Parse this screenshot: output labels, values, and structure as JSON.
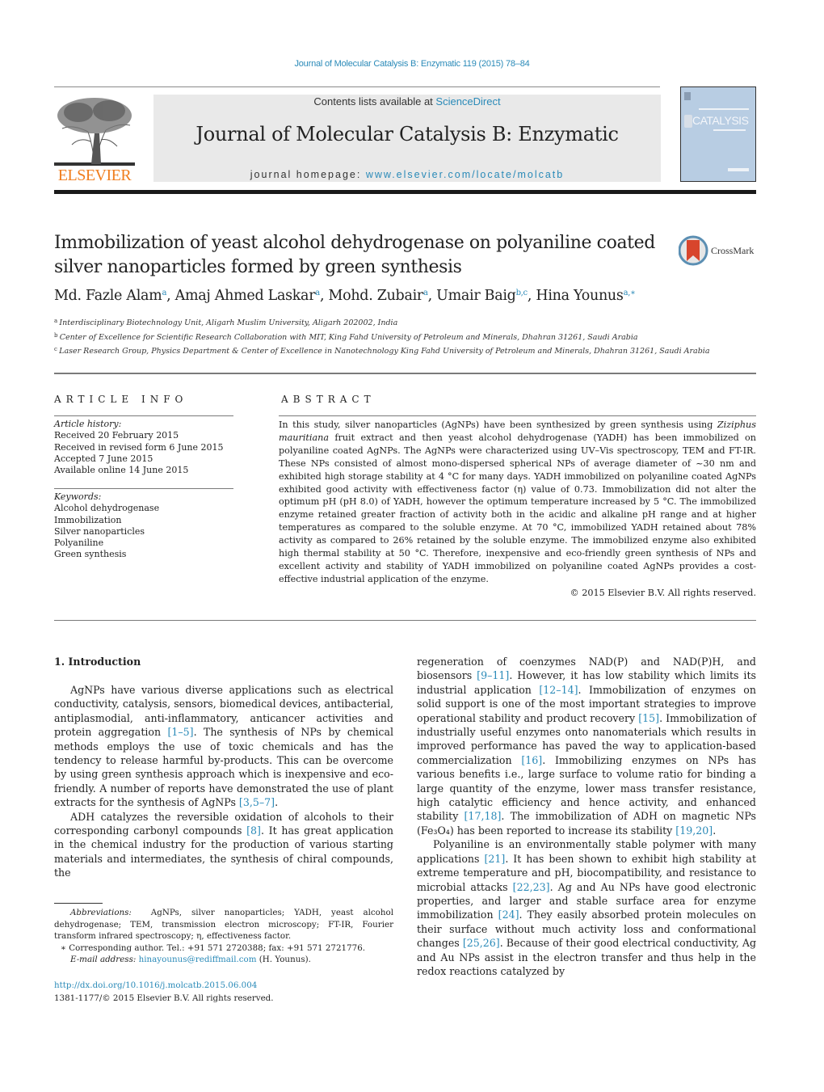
{
  "header": {
    "citation": "Journal of Molecular Catalysis B: Enzymatic 119 (2015) 78–84",
    "contents_prefix": "Contents lists available at ",
    "contents_link": "ScienceDirect",
    "journal_title": "Journal of Molecular Catalysis B: Enzymatic",
    "homepage_prefix": "journal homepage: ",
    "homepage_link": "www.elsevier.com/locate/molcatb",
    "publisher_logo_text": "ELSEVIER",
    "cover_title": "CATALYSIS",
    "accent_color": "#2a8ab8",
    "logo_color": "#f07e1e"
  },
  "article": {
    "title": "Immobilization of yeast alcohol dehydrogenase on polyaniline coated silver nanoparticles formed by green synthesis",
    "crossmark_label": "CrossMark",
    "authors": [
      {
        "name": "Md. Fazle Alam",
        "sup": "a",
        "sep": ", "
      },
      {
        "name": "Amaj Ahmed Laskar",
        "sup": "a",
        "sep": ", "
      },
      {
        "name": "Mohd. Zubair",
        "sup": "a",
        "sep": ", "
      },
      {
        "name": "Umair Baig",
        "sup": "b,c",
        "sep": ", "
      },
      {
        "name": "Hina Younus",
        "sup": "a,∗",
        "sep": ""
      }
    ],
    "affiliations": [
      {
        "key": "a",
        "text": "Interdisciplinary Biotechnology Unit, Aligarh Muslim University, Aligarh 202002, India"
      },
      {
        "key": "b",
        "text": "Center of Excellence for Scientific Research Collaboration with MIT, King Fahd University of Petroleum and Minerals, Dhahran 31261, Saudi Arabia"
      },
      {
        "key": "c",
        "text": "Laser Research Group, Physics Department & Center of Excellence in Nanotechnology King Fahd University of Petroleum and Minerals, Dhahran 31261, Saudi Arabia"
      }
    ]
  },
  "article_info": {
    "heading": "ARTICLE INFO",
    "history_label": "Article history:",
    "history": [
      "Received 20 February 2015",
      "Received in revised form 6 June 2015",
      "Accepted 7 June 2015",
      "Available online 14 June 2015"
    ],
    "keywords_label": "Keywords:",
    "keywords": [
      "Alcohol dehydrogenase",
      "Immobilization",
      "Silver nanoparticles",
      "Polyaniline",
      "Green synthesis"
    ]
  },
  "abstract": {
    "heading": "ABSTRACT",
    "text_1": "In this study, silver nanoparticles (AgNPs) have been synthesized by green synthesis using ",
    "species": "Ziziphus mauritiana",
    "text_2": " fruit extract and then yeast alcohol dehydrogenase (YADH) has been immobilized on polyaniline coated AgNPs. The AgNPs were characterized using UV–Vis spectroscopy, TEM and FT-IR. These NPs consisted of almost mono-dispersed spherical NPs of average diameter of ~30 nm and exhibited high storage stability at 4 °C for many days. YADH immobilized on polyaniline coated AgNPs exhibited good activity with effectiveness factor (η) value of 0.73. Immobilization did not alter the optimum pH (pH 8.0) of YADH, however the optimum temperature increased by 5 °C. The immobilized enzyme retained greater fraction of activity both in the acidic and alkaline pH range and at higher temperatures as compared to the soluble enzyme. At 70 °C, immobilized YADH retained about 78% activity as compared to 26% retained by the soluble enzyme. The immobilized enzyme also exhibited high thermal stability at 50 °C. Therefore, inexpensive and eco-friendly green synthesis of NPs and excellent activity and stability of YADH immobilized on polyaniline coated AgNPs provides a cost-effective industrial application of the enzyme.",
    "copyright": "© 2015 Elsevier B.V. All rights reserved."
  },
  "introduction": {
    "heading": "1.  Introduction",
    "p1": [
      {
        "t": "AgNPs have various diverse applications such as electrical conductivity, catalysis, sensors, biomedical devices, antibacterial, antiplasmodial, anti-inflammatory, anticancer activities and protein aggregation "
      },
      {
        "ref": "[1–5]"
      },
      {
        "t": ". The synthesis of NPs by chemical methods employs the use of toxic chemicals and has the tendency to release harmful by-products. This can be overcome by using green synthesis approach which is inexpensive and eco-friendly. A number of reports have demonstrated the use of plant extracts for the synthesis of AgNPs "
      },
      {
        "ref": "[3,5–7]"
      },
      {
        "t": "."
      }
    ],
    "p2": [
      {
        "t": "ADH catalyzes the reversible oxidation of alcohols to their corresponding carbonyl compounds "
      },
      {
        "ref": "[8]"
      },
      {
        "t": ". It has great application in the chemical industry for the production of various starting materials and intermediates, the synthesis of chiral compounds, the "
      }
    ],
    "p2_cont": [
      {
        "t": "regeneration of coenzymes NAD(P) and NAD(P)H, and biosensors "
      },
      {
        "ref": "[9–11]"
      },
      {
        "t": ". However, it has low stability which limits its industrial application "
      },
      {
        "ref": "[12–14]"
      },
      {
        "t": ". Immobilization of enzymes on solid support is one of the most important strategies to improve operational stability and product recovery "
      },
      {
        "ref": "[15]"
      },
      {
        "t": ". Immobilization of industrially useful enzymes onto nanomaterials which results in improved performance has paved the way to application-based commercialization "
      },
      {
        "ref": "[16]"
      },
      {
        "t": ". Immobilizing enzymes on NPs has various benefits i.e., large surface to volume ratio for binding a large quantity of the enzyme, lower mass transfer resistance, high catalytic efficiency and hence activity, and enhanced stability "
      },
      {
        "ref": "[17,18]"
      },
      {
        "t": ". The immobilization of ADH on magnetic NPs (Fe₃O₄) has been reported to increase its stability "
      },
      {
        "ref": "[19,20]"
      },
      {
        "t": "."
      }
    ],
    "p3": [
      {
        "t": "Polyaniline is an environmentally stable polymer with many applications "
      },
      {
        "ref": "[21]"
      },
      {
        "t": ". It has been shown to exhibit high stability at extreme temperature and pH, biocompatibility, and resistance to microbial attacks "
      },
      {
        "ref": "[22,23]"
      },
      {
        "t": ". Ag and Au NPs have good electronic properties, and larger and stable surface area for enzyme immobilization "
      },
      {
        "ref": "[24]"
      },
      {
        "t": ". They easily absorbed protein molecules on their surface without much activity loss and conformational changes "
      },
      {
        "ref": "[25,26]"
      },
      {
        "t": ". Because of their good electrical conductivity, Ag and Au NPs assist in the electron transfer and thus help in the redox reactions catalyzed by"
      }
    ]
  },
  "footnotes": {
    "abbrev_label": "Abbreviations:",
    "abbrev_text": "AgNPs, silver nanoparticles; YADH, yeast alcohol dehydrogenase; TEM, transmission electron microscopy; FT-IR, Fourier transform infrared spectroscopy; η, effectiveness factor.",
    "corresponding": "∗  Corresponding author. Tel.: +91 571 2720388; fax: +91 571 2721776.",
    "email_label": "E-mail address:",
    "email": "hinayounus@rediffmail.com",
    "email_suffix": " (H. Younus).",
    "doi": "http://dx.doi.org/10.1016/j.molcatb.2015.06.004",
    "issn": "1381-1177/© 2015 Elsevier B.V. All rights reserved."
  }
}
